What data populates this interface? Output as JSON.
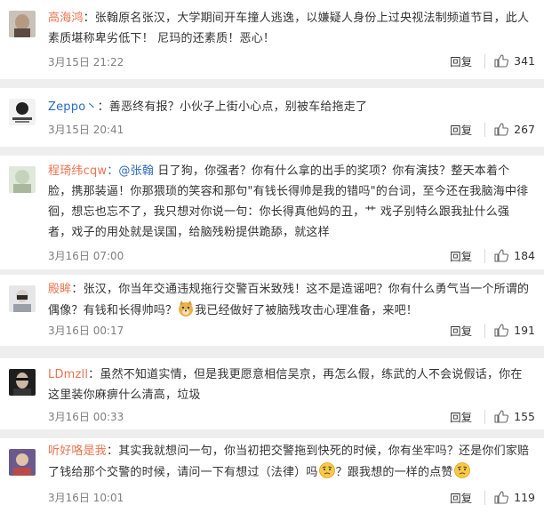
{
  "comments": [
    {
      "user": "高海鸿",
      "text": "：张翰原名张汉，大学期间开车撞人逃逸，以嫌疑人身份上过央视法制频道节目，此人素质堪称卑劣低下！    尼玛的还素质！恶心！",
      "date": "3月15日 21:22",
      "reply": "回复",
      "likes": "341"
    },
    {
      "user": "Zeppo丶",
      "text": "：善恶终有报？小伙子上街小心点，别被车给拖走了",
      "date": "3月15日 20:41",
      "reply": "回复",
      "likes": "267"
    },
    {
      "user": "程琦纬cqw",
      "mention": "：@张翰",
      "text": " 日了狗，你强者？你有什么拿的出手的奖项？你有演技？整天本着个脸，携那装逼！你那猥琐的笑容和那句\"有钱长得帅是我的错吗\"的台词，至今还在我脑海中徘徊，想忘也忘不了，我只想对你说一句：你长得真他妈的丑，艹 戏子别特么跟我扯什么强者，戏子的用处就是误国，给脑残粉提供跪舔，就这样",
      "date": "3月16日 07:00",
      "reply": "回复",
      "likes": "184"
    },
    {
      "user": "殿眸",
      "text": "：张汉，你当年交通违规拖行交警百米致残！这不是造谣吧？你有什么勇气当一个所谓的偶像？有钱和长得帅吗？",
      "text2": "我已经做好了被脑残攻击心理准备，来吧！",
      "date": "3月16日 00:17",
      "reply": "回复",
      "likes": "191"
    },
    {
      "user": "LDmzll",
      "text": "：虽然不知道实情，但是我更愿意相信吴京，再怎么假，练武的人不会说假话，你在这里装你麻痹什么清高，垃圾",
      "date": "3月16日 00:33",
      "reply": "回复",
      "likes": "155"
    },
    {
      "user": "听好咯是我",
      "text": "：其实我就想问一句，你当初把交警拖到快死的时候，你有坐牢吗？还是你们家赔了钱给那个交警的时候，请问一下有想过（法律）吗",
      "text2": "？跟我想的一样的点赞",
      "date": "3月16日 10:01",
      "reply": "回复",
      "likes": "119"
    }
  ],
  "colors": {
    "username": "#eb7350",
    "mention": "#2a6bbf",
    "meta": "#808080",
    "background": "#eeeeee"
  },
  "icons": {
    "like": "thumbs-up-icon",
    "emoji_thinking": "thinking-face-emoji",
    "emoji_doge": "doge-emoji"
  }
}
